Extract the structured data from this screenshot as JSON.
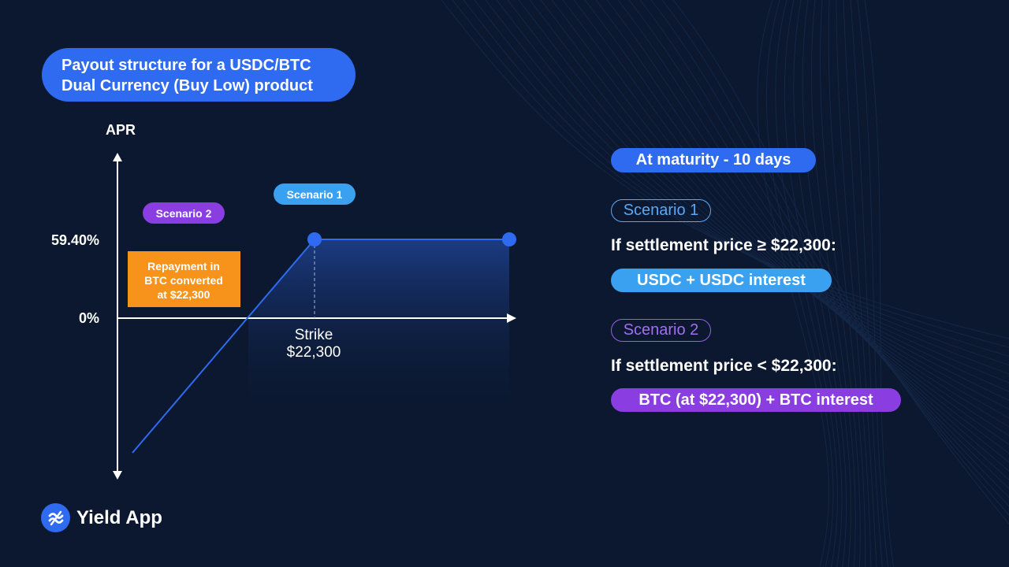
{
  "title": {
    "line1": "Payout structure for a USDC/BTC",
    "line2": "Dual Currency (Buy Low) product"
  },
  "chart_data": {
    "type": "line",
    "ylabel": "APR",
    "y_tick_labels": [
      "59.40%",
      "0%"
    ],
    "strike_label": [
      "Strike",
      "$22,300"
    ],
    "series": [
      {
        "points": [
          {
            "x": "below strike",
            "y": "negative"
          },
          {
            "x": "$22,300",
            "y": "59.40%"
          },
          {
            "x": "above strike",
            "y": "59.40%"
          }
        ]
      }
    ],
    "annotations": {
      "scenario1": "Scenario 1",
      "scenario2": "Scenario 2",
      "repayment": [
        "Repayment in",
        "BTC converted",
        "at $22,300"
      ]
    },
    "colors": {
      "line": "#2f6bf0",
      "scenario1": "#3aa0f0",
      "scenario2": "#8a3de0",
      "repayment": "#f7931a",
      "axis": "#ffffff"
    }
  },
  "panel": {
    "maturity": "At maturity - 10 days",
    "scenario1_label": "Scenario 1",
    "scenario1_condition": "If settlement price ≥ $22,300:",
    "scenario1_result": "USDC + USDC interest",
    "scenario2_label": "Scenario 2",
    "scenario2_condition": "If settlement price < $22,300:",
    "scenario2_result": "BTC (at $22,300) + BTC interest"
  },
  "brand": {
    "name": "Yield App",
    "icon": "yield-app-logo-icon"
  }
}
